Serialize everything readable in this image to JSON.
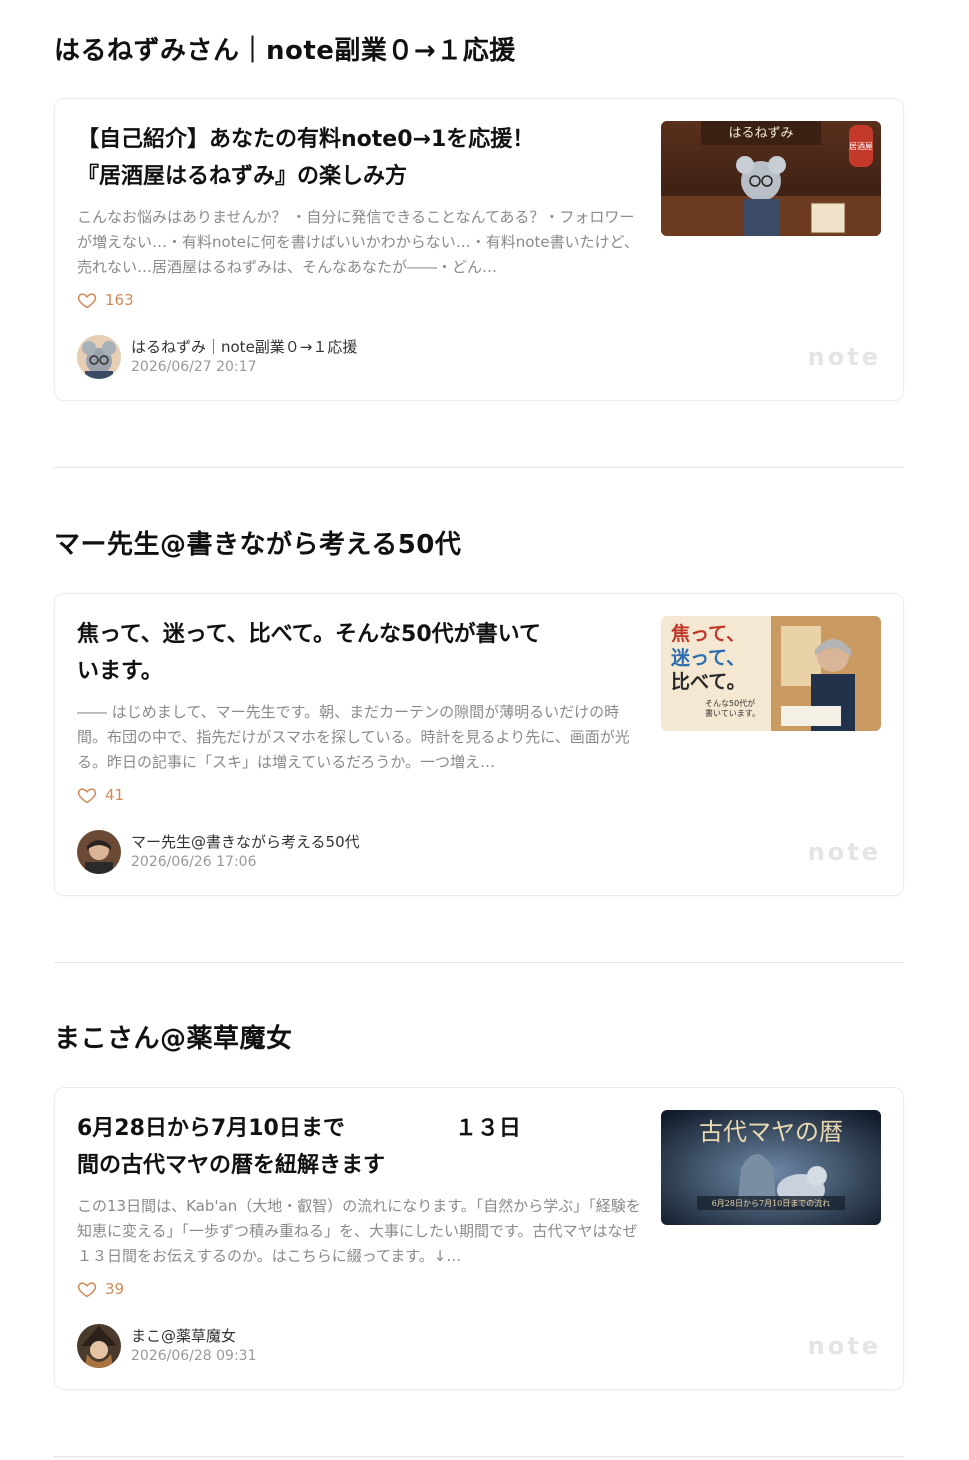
{
  "sections": [
    {
      "title": "はるねずみさん｜note副業０→１応援",
      "card": {
        "title": "【自己紹介】あなたの有料note0→1を応援！\n『居酒屋はるねずみ』の楽しみ方",
        "excerpt": "こんなお悩みはありませんか？ ・自分に発信できることなんてある？・フォロワーが増えない…・有料noteに何を書けばいいかわからない…・有料note書いたけど、売れない…居酒屋はるねずみは、そんなあなたが――・どん…",
        "likes": "163",
        "author": "はるねずみ｜note副業０→１応援",
        "date": "2026/06/27 20:17",
        "thumb_text": "はるねずみ",
        "thumb_sign": "居酒屋",
        "logo": "note"
      }
    },
    {
      "title": "マー先生@書きながら考える50代",
      "card": {
        "title": "焦って、迷って、比べて。そんな50代が書いて\nいます。",
        "excerpt": "―― はじめまして、マー先生です。朝、まだカーテンの隙間が薄明るいだけの時間。布団の中で、指先だけがスマホを探している。時計を見るより先に、画面が光る。昨日の記事に「スキ」は増えているだろうか。一つ増え…",
        "likes": "41",
        "author": "マー先生@書きながら考える50代",
        "date": "2026/06/26 17:06",
        "thumb_line1": "焦って、",
        "thumb_line2": "迷って、",
        "thumb_line3": "比べて。",
        "thumb_sub1": "そんな50代が",
        "thumb_sub2": "書いています。",
        "logo": "note"
      }
    },
    {
      "title": "まこさん@薬草魔女",
      "card": {
        "title": "6月28日から7月10日まで　　　　　１３日\n間の古代マヤの暦を紐解きます",
        "excerpt": "この13日間は、Kab'an（大地・叡智）の流れになります。「自然から学ぶ」「経験を知恵に変える」「一歩ずつ積み重ねる」を、大事にしたい期間です。古代マヤはなぜ１３日間をお伝えするのか。はこちらに綴ってます。↓…",
        "likes": "39",
        "author": "まこ@薬草魔女",
        "date": "2026/06/28 09:31",
        "thumb_title": "古代マヤの暦",
        "thumb_sub": "6月28日から7月10日までの流れ",
        "logo": "note"
      }
    }
  ],
  "colors": {
    "like": "#d08a5a",
    "divider": "#e3e3e3",
    "excerpt": "#8a8a8a"
  }
}
